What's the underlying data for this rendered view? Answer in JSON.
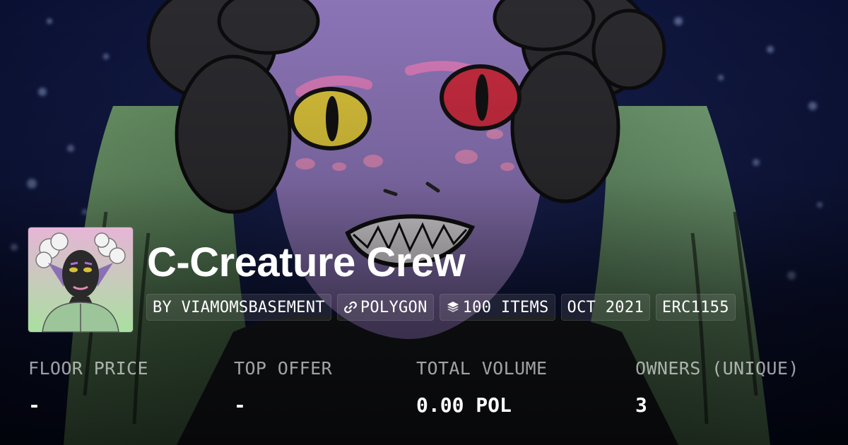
{
  "collection": {
    "name": "C-Creature Crew"
  },
  "pills": [
    {
      "label": "BY VIAMOMSBASEMENT",
      "icon": ""
    },
    {
      "label": "POLYGON",
      "icon": "link-icon"
    },
    {
      "label": "100 ITEMS",
      "icon": "layers-icon"
    },
    {
      "label": "OCT 2021",
      "icon": ""
    },
    {
      "label": "ERC1155",
      "icon": ""
    }
  ],
  "stats": [
    {
      "label": "FLOOR PRICE",
      "value": "-"
    },
    {
      "label": "TOP OFFER",
      "value": "-"
    },
    {
      "label": "TOTAL VOLUME",
      "value": "0.00 POL"
    },
    {
      "label": "OWNERS (UNIQUE)",
      "value": "3"
    }
  ],
  "colors": {
    "background": "#0b1238",
    "creature_skin": "#8b74b6",
    "fins": "#7fae79",
    "text": "#ffffff"
  }
}
